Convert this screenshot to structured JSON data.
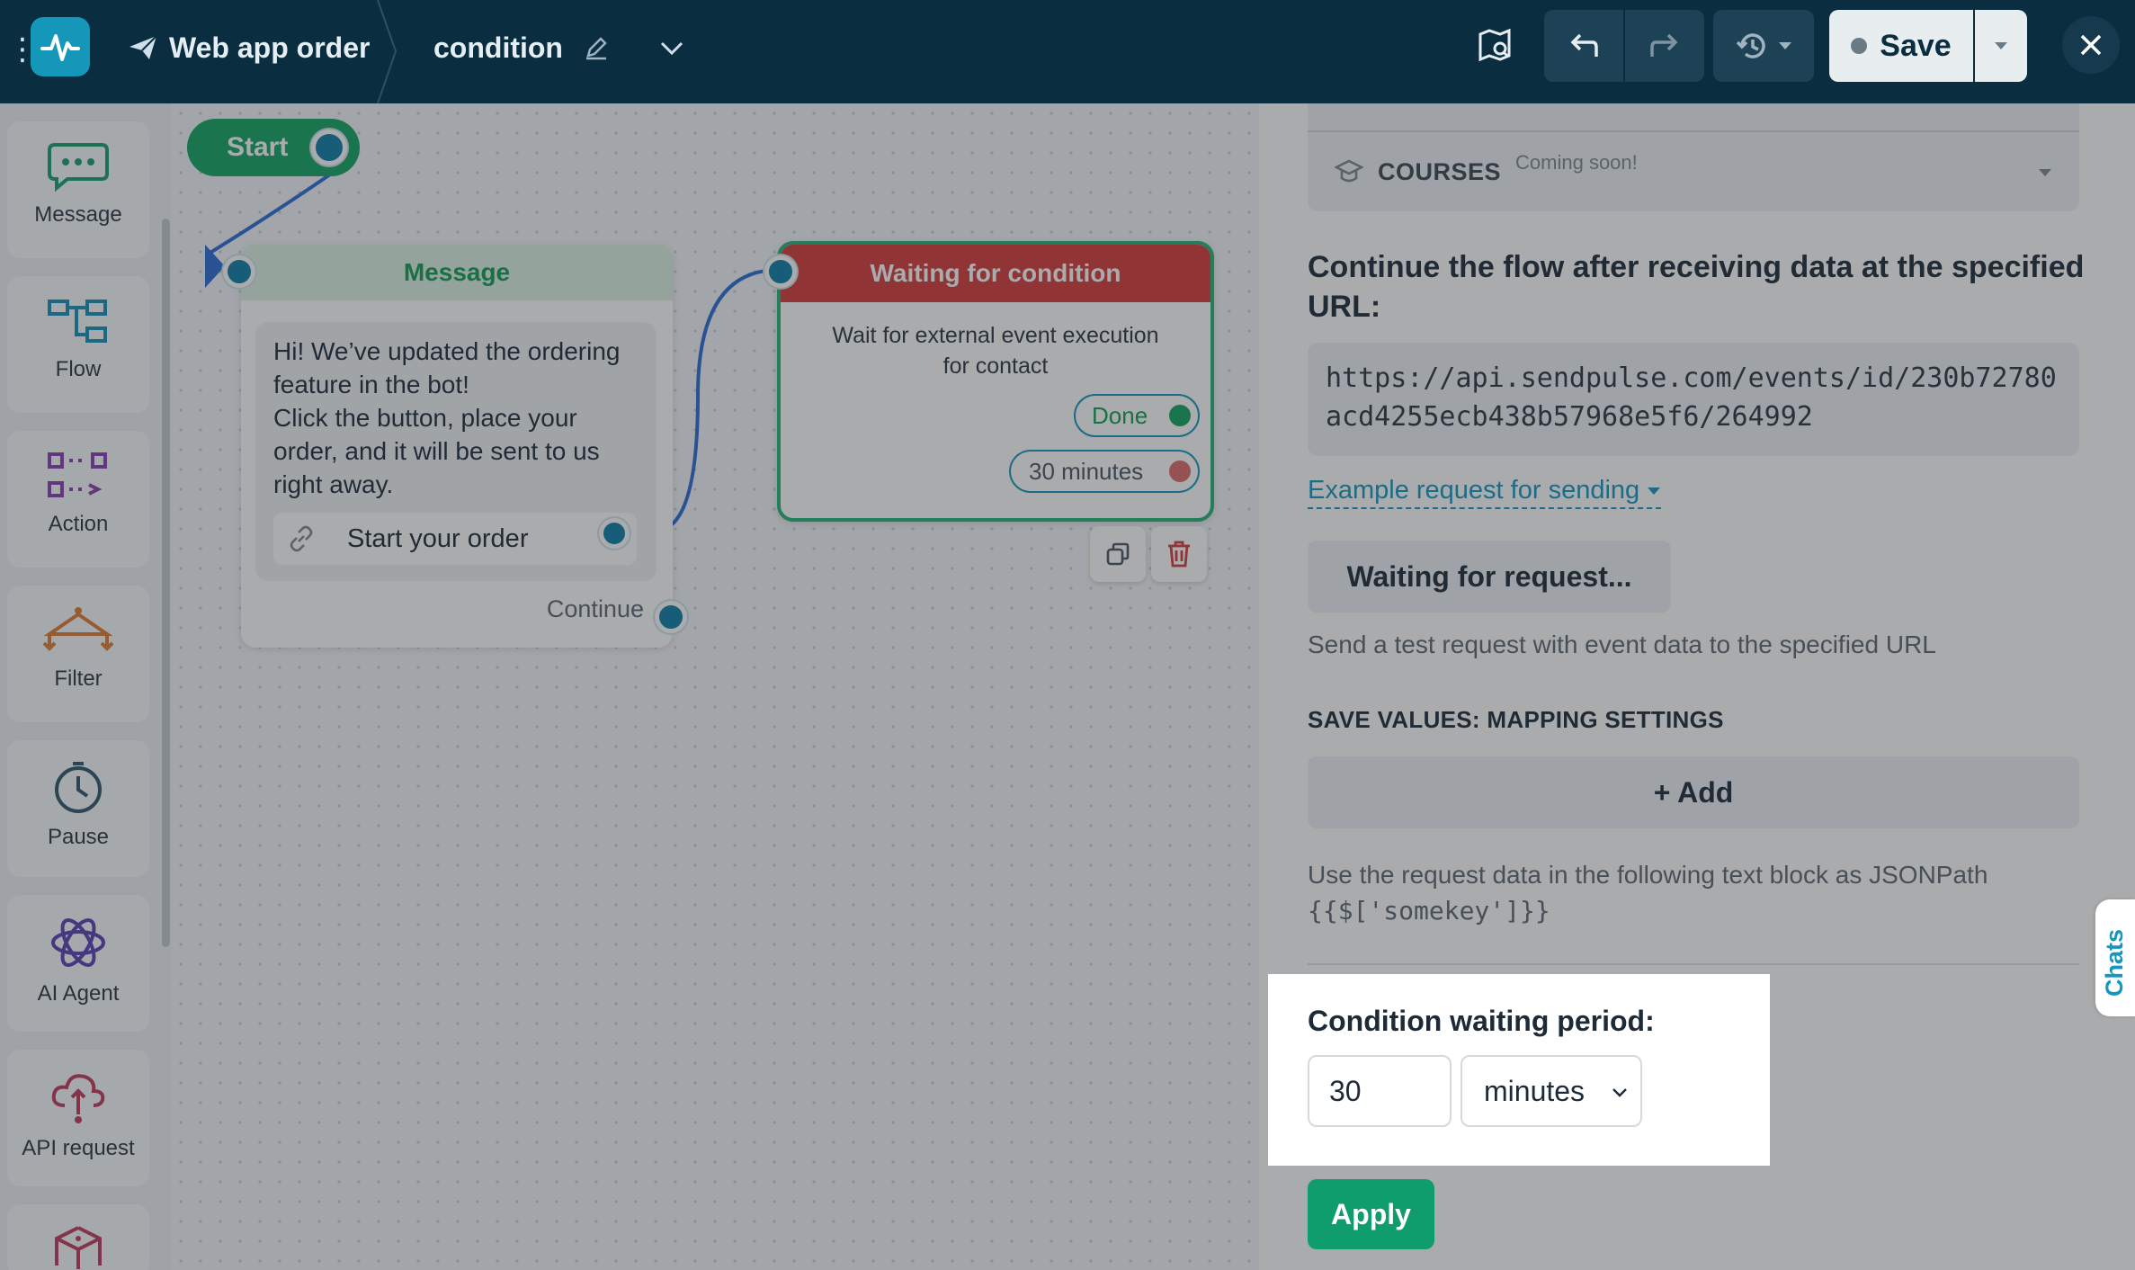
{
  "topbar": {
    "flow_name": "Web app order",
    "node_name": "condition",
    "save_label": "Save"
  },
  "leftbar": {
    "tools": [
      {
        "label": "Message",
        "icon": "message-bubble-icon"
      },
      {
        "label": "Flow",
        "icon": "flow-icon"
      },
      {
        "label": "Action",
        "icon": "action-icon"
      },
      {
        "label": "Filter",
        "icon": "filter-icon"
      },
      {
        "label": "Pause",
        "icon": "clock-icon"
      },
      {
        "label": "AI Agent",
        "icon": "ai-agent-icon"
      },
      {
        "label": "API request",
        "icon": "api-cloud-icon"
      },
      {
        "label": "",
        "icon": "dice-icon"
      }
    ]
  },
  "canvas": {
    "start_label": "Start",
    "message_node": {
      "title": "Message",
      "line1": "Hi! We’ve updated the ordering",
      "line2": "feature in the bot!",
      "line3": "Click the button, place your",
      "line4": "order, and it will be sent to us",
      "line5": "right away.",
      "button_label": "Start your order",
      "continue_label": "Continue"
    },
    "wait_node": {
      "title": "Waiting for condition",
      "desc_line1": "Wait for external event execution",
      "desc_line2": "for contact",
      "done_label": "Done",
      "timeout_label": "30 minutes"
    }
  },
  "panel": {
    "courses_label": "COURSES",
    "courses_badge": "Coming soon!",
    "title": "Continue the flow after receiving data at the specified URL:",
    "url": "https://api.sendpulse.com/events/id/230b72780acd4255ecb438b57968e5f6/264992",
    "example_link": "Example request for sending",
    "waiting_button": "Waiting for request...",
    "test_hint": "Send a test request with event data to the specified URL",
    "mapping_title": "SAVE VALUES: MAPPING SETTINGS",
    "add_button": "+ Add",
    "jsonpath_hint": "Use the request data in the following text block as JSONPath",
    "jsonpath_code": "{{$['somekey']}}",
    "waiting_period_title": "Condition waiting period:",
    "waiting_period_value": "30",
    "waiting_period_unit": "minutes",
    "apply_button": "Apply",
    "chats_tab": "Chats"
  },
  "colors": {
    "topbar": "#0b2d40",
    "accent": "#1596c0",
    "start_green": "#12a360",
    "wait_red": "#d63a3a",
    "apply_green": "#0f9d6d"
  }
}
